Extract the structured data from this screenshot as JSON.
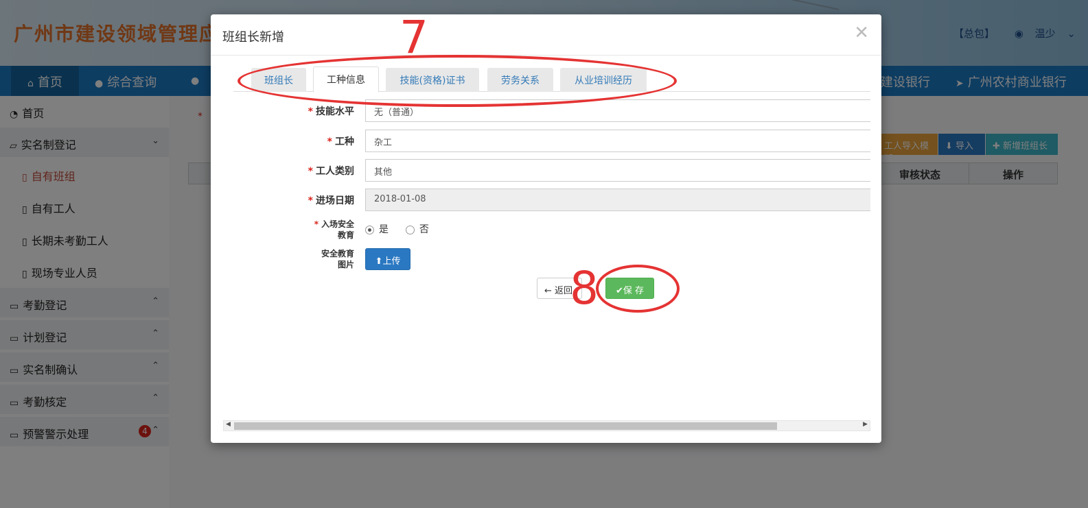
{
  "header": {
    "title": "广州市建设领域管理应",
    "role": "【总包】",
    "user": "温少"
  },
  "nav": {
    "items": [
      "首页",
      "综合查询",
      "建设银行",
      "广州农村商业银行"
    ]
  },
  "sidebar": {
    "items": [
      {
        "label": "首页",
        "type": "top"
      },
      {
        "label": "实名制登记",
        "type": "group",
        "chevron": "down"
      },
      {
        "label": "自有班组",
        "type": "sub",
        "current": true
      },
      {
        "label": "自有工人",
        "type": "sub"
      },
      {
        "label": "长期未考勤工人",
        "type": "sub"
      },
      {
        "label": "现场专业人员",
        "type": "sub"
      },
      {
        "label": "考勤登记",
        "type": "group",
        "chevron": "up"
      },
      {
        "label": "计划登记",
        "type": "group",
        "chevron": "up"
      },
      {
        "label": "实名制确认",
        "type": "group",
        "chevron": "up"
      },
      {
        "label": "考勤核定",
        "type": "group",
        "chevron": "up"
      },
      {
        "label": "预警警示处理",
        "type": "group",
        "chevron": "up",
        "badge": "4"
      }
    ]
  },
  "content": {
    "buttons": {
      "template": "工人导入模版",
      "import": "导入",
      "add": "新增班组长"
    },
    "table_headers": [
      "审核状态",
      "操作"
    ]
  },
  "modal": {
    "title": "班组长新增",
    "tabs": [
      "班组长",
      "工种信息",
      "技能(资格)证书",
      "劳务关系",
      "从业培训经历"
    ],
    "active_tab": "工种信息",
    "fields": {
      "skill_level": {
        "label": "技能水平",
        "value": "无（普通）"
      },
      "work_type": {
        "label": "工种",
        "value": "杂工"
      },
      "worker_category": {
        "label": "工人类别",
        "value": "其他"
      },
      "entry_date": {
        "label": "进场日期",
        "value": "2018-01-08"
      },
      "safety_education": {
        "label_line1": "入场安全",
        "label_line2": "教育",
        "yes": "是",
        "no": "否",
        "selected": "是"
      },
      "safety_photo": {
        "label_line1": "安全教育",
        "label_line2": "图片",
        "button": "上传"
      }
    },
    "back_label": "返回",
    "save_label": "保 存"
  },
  "annotations": {
    "first": "7",
    "second": "8",
    "color": "#e53333"
  }
}
